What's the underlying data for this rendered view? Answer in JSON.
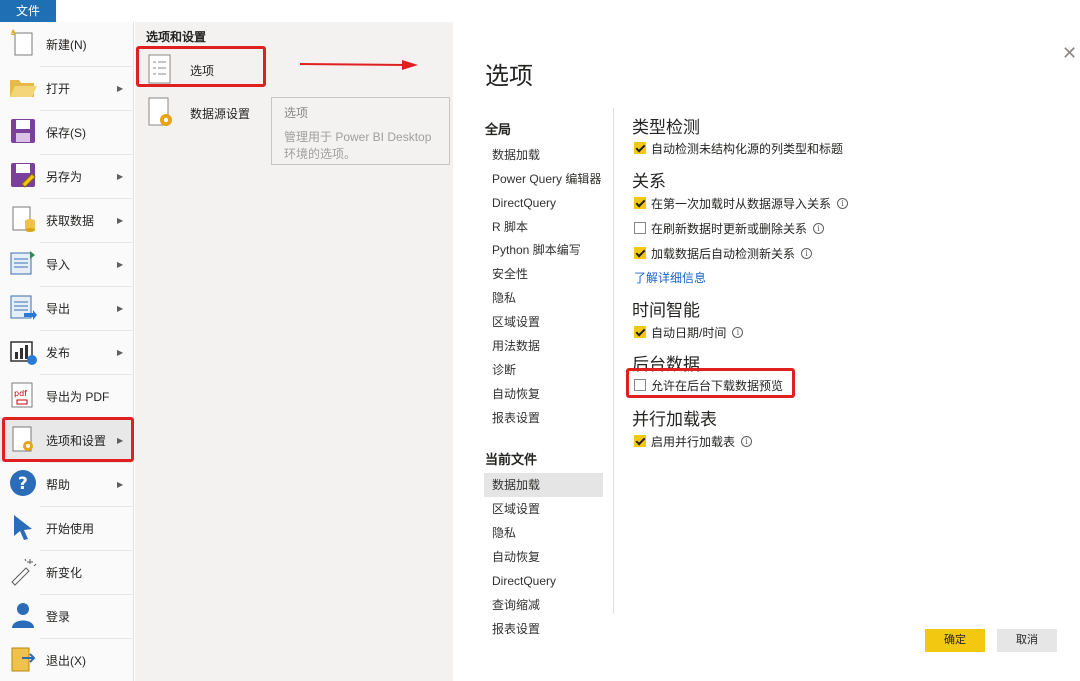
{
  "file_tab": "文件",
  "menu": {
    "items": [
      {
        "label": "新建(N)",
        "icon": "new-file-icon",
        "arrow": false
      },
      {
        "label": "打开",
        "icon": "folder-open-icon",
        "arrow": true
      },
      {
        "label": "保存(S)",
        "icon": "save-icon",
        "arrow": false
      },
      {
        "label": "另存为",
        "icon": "save-as-icon",
        "arrow": true
      },
      {
        "label": "获取数据",
        "icon": "get-data-icon",
        "arrow": true
      },
      {
        "label": "导入",
        "icon": "import-icon",
        "arrow": true
      },
      {
        "label": "导出",
        "icon": "export-icon",
        "arrow": true
      },
      {
        "label": "发布",
        "icon": "publish-icon",
        "arrow": true
      },
      {
        "label": "导出为 PDF",
        "icon": "pdf-icon",
        "arrow": false
      },
      {
        "label": "选项和设置",
        "icon": "options-settings-icon",
        "arrow": true
      },
      {
        "label": "帮助",
        "icon": "help-icon",
        "arrow": true
      },
      {
        "label": "开始使用",
        "icon": "getting-started-icon",
        "arrow": false
      },
      {
        "label": "新变化",
        "icon": "whats-new-icon",
        "arrow": false
      },
      {
        "label": "登录",
        "icon": "user-icon",
        "arrow": false
      },
      {
        "label": "退出(X)",
        "icon": "exit-icon",
        "arrow": false
      }
    ],
    "arrow_glyph": "▶"
  },
  "submenu": {
    "title": "选项和设置",
    "items": [
      {
        "label": "选项",
        "icon": "options-doc-icon"
      },
      {
        "label": "数据源设置",
        "icon": "datasource-settings-icon"
      }
    ],
    "tooltip": {
      "title": "选项",
      "desc": "管理用于 Power BI Desktop 环境的选项。"
    }
  },
  "dialog": {
    "title": "选项",
    "close": "✕",
    "global_heading": "全局",
    "global_items": [
      "数据加载",
      "Power Query 编辑器",
      "DirectQuery",
      "R 脚本",
      "Python 脚本编写",
      "安全性",
      "隐私",
      "区域设置",
      "用法数据",
      "诊断",
      "自动恢复",
      "报表设置"
    ],
    "current_heading": "当前文件",
    "current_items": [
      "数据加载",
      "区域设置",
      "隐私",
      "自动恢复",
      "DirectQuery",
      "查询缩减",
      "报表设置"
    ],
    "selected_current": "数据加载",
    "sections": {
      "type_detect": {
        "heading": "类型检测",
        "options": [
          {
            "label": "自动检测未结构化源的列类型和标题",
            "checked": true,
            "info": false
          }
        ]
      },
      "relationships": {
        "heading": "关系",
        "options": [
          {
            "label": "在第一次加载时从数据源导入关系",
            "checked": true,
            "info": true
          },
          {
            "label": "在刷新数据时更新或删除关系",
            "checked": false,
            "info": true
          },
          {
            "label": "加载数据后自动检测新关系",
            "checked": true,
            "info": true
          }
        ],
        "link": "了解详细信息"
      },
      "time_intel": {
        "heading": "时间智能",
        "options": [
          {
            "label": "自动日期/时间",
            "checked": true,
            "info": true
          }
        ]
      },
      "background": {
        "heading": "后台数据",
        "options": [
          {
            "label": "允许在后台下载数据预览",
            "checked": false,
            "info": false
          }
        ]
      },
      "parallel": {
        "heading": "并行加载表",
        "options": [
          {
            "label": "启用并行加载表",
            "checked": true,
            "info": true
          }
        ]
      }
    },
    "info_glyph": "i",
    "ok_label": "确定",
    "cancel_label": "取消"
  },
  "colors": {
    "accent_yellow": "#f2c811",
    "highlight_red": "#e02020",
    "link_blue": "#1a64c7",
    "file_tab_blue": "#1f6fb5"
  }
}
